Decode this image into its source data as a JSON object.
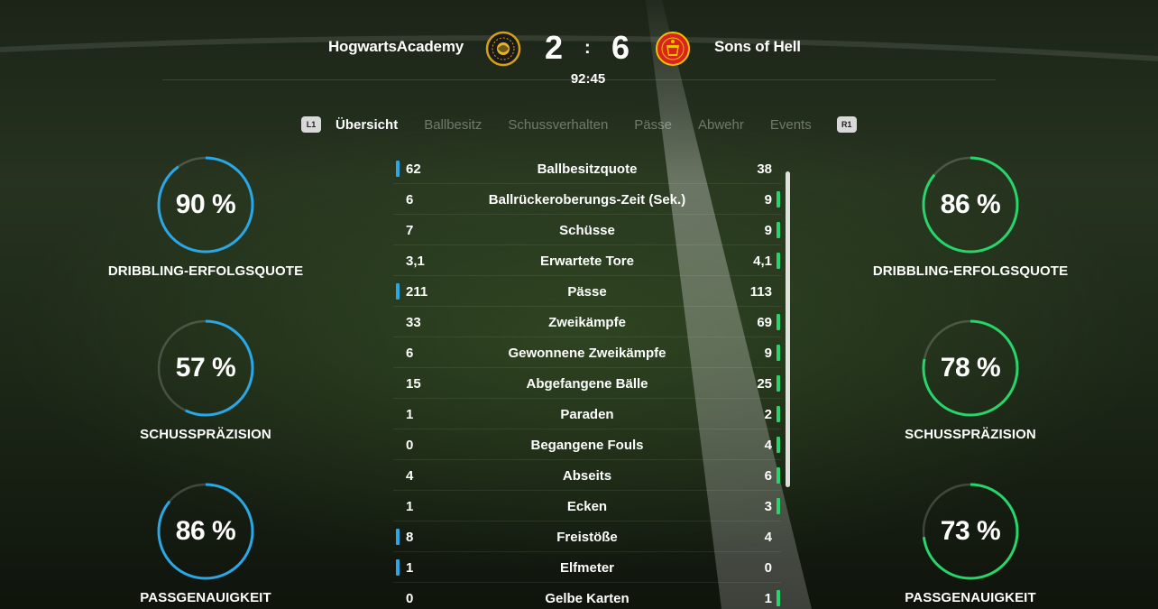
{
  "match": {
    "home_team": "HogwartsAcademy",
    "away_team": "Sons of Hell",
    "home_score": "2",
    "separator": ":",
    "away_score": "6",
    "time": "92:45"
  },
  "tabs": {
    "left_button": "L1",
    "right_button": "R1",
    "items": [
      "Übersicht",
      "Ballbesitz",
      "Schussverhalten",
      "Pässe",
      "Abwehr",
      "Events"
    ],
    "active": "Übersicht"
  },
  "colors": {
    "home_accent": "#2aa7e6",
    "away_accent": "#27d56a"
  },
  "home_rings": [
    {
      "value": "90 %",
      "fraction": 0.9,
      "label": "DRIBBLING-ERFOLGSQUOTE"
    },
    {
      "value": "57 %",
      "fraction": 0.57,
      "label": "SCHUSSPRÄZISION"
    },
    {
      "value": "86 %",
      "fraction": 0.86,
      "label": "PASSGENAUIGKEIT"
    }
  ],
  "away_rings": [
    {
      "value": "86 %",
      "fraction": 0.86,
      "label": "DRIBBLING-ERFOLGSQUOTE"
    },
    {
      "value": "78 %",
      "fraction": 0.78,
      "label": "SCHUSSPRÄZISION"
    },
    {
      "value": "73 %",
      "fraction": 0.73,
      "label": "PASSGENAUIGKEIT"
    }
  ],
  "stats": [
    {
      "home": "62",
      "label": "Ballbesitzquote",
      "away": "38",
      "leader": "home"
    },
    {
      "home": "6",
      "label": "Ballrückeroberungs-Zeit (Sek.)",
      "away": "9",
      "leader": "away"
    },
    {
      "home": "7",
      "label": "Schüsse",
      "away": "9",
      "leader": "away"
    },
    {
      "home": "3,1",
      "label": "Erwartete Tore",
      "away": "4,1",
      "leader": "away"
    },
    {
      "home": "211",
      "label": "Pässe",
      "away": "113",
      "leader": "home"
    },
    {
      "home": "33",
      "label": "Zweikämpfe",
      "away": "69",
      "leader": "away"
    },
    {
      "home": "6",
      "label": "Gewonnene Zweikämpfe",
      "away": "9",
      "leader": "away"
    },
    {
      "home": "15",
      "label": "Abgefangene Bälle",
      "away": "25",
      "leader": "away"
    },
    {
      "home": "1",
      "label": "Paraden",
      "away": "2",
      "leader": "away"
    },
    {
      "home": "0",
      "label": "Begangene Fouls",
      "away": "4",
      "leader": "away"
    },
    {
      "home": "4",
      "label": "Abseits",
      "away": "6",
      "leader": "away"
    },
    {
      "home": "1",
      "label": "Ecken",
      "away": "3",
      "leader": "away"
    },
    {
      "home": "8",
      "label": "Freistöße",
      "away": "4",
      "leader": "home"
    },
    {
      "home": "1",
      "label": "Elfmeter",
      "away": "0",
      "leader": "home"
    },
    {
      "home": "0",
      "label": "Gelbe Karten",
      "away": "1",
      "leader": "away"
    }
  ],
  "icons": {
    "home_crest": "hogwarts-crest-icon",
    "away_crest": "manchester-united-crest-icon"
  }
}
